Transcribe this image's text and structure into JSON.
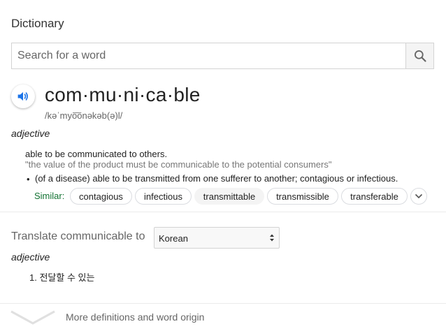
{
  "card": {
    "title": "Dictionary",
    "search": {
      "placeholder": "Search for a word"
    },
    "entry": {
      "word": "com·mu·ni·ca·ble",
      "phonetic": "/kəˈmyo͞onəkəb(ə)l/",
      "part_of_speech": "adjective",
      "definitions": [
        {
          "text": "able to be communicated to others.",
          "example": "\"the value of the product must be communicable to the potential consumers\""
        },
        {
          "bullet": "•",
          "text": "(of a disease) able to be transmitted from one sufferer to another; contagious or infectious."
        }
      ],
      "similar": {
        "label": "Similar:",
        "words": [
          "contagious",
          "infectious",
          "transmittable",
          "transmissible",
          "transferable"
        ]
      }
    },
    "translate": {
      "label": "Translate communicable to",
      "language": "Korean",
      "part_of_speech": "adjective",
      "items": [
        "1. 전달할 수 있는"
      ]
    },
    "footer": {
      "more_label": "More definitions and word origin"
    }
  },
  "colors": {
    "similar_label": "#137333",
    "speaker_blue": "#1a73e8"
  }
}
